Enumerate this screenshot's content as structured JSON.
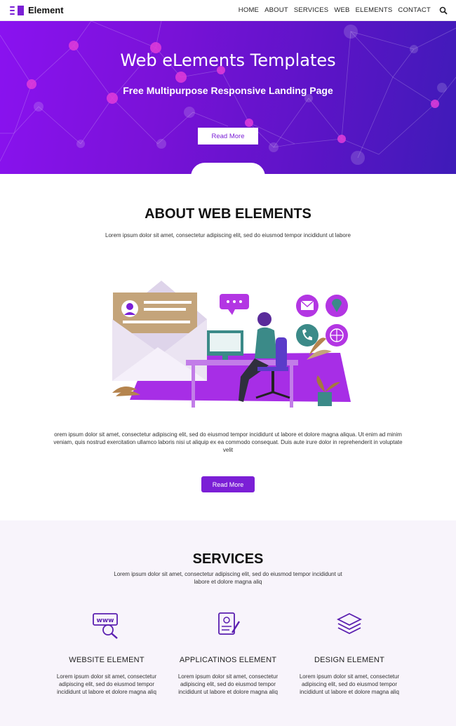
{
  "nav": {
    "brand": "Element",
    "items": [
      "HOME",
      "ABOUT",
      "SERVICES",
      "WEB",
      "ELEMENTS",
      "CONTACT"
    ],
    "search_icon": "search-icon"
  },
  "hero": {
    "title": "Web eLements Templates",
    "subtitle": "Free Multipurpose Responsive Landing Page",
    "button": "Read More"
  },
  "about": {
    "title": "ABOUT WEB ELEMENTS",
    "lead": "Lorem ipsum dolor sit amet, consectetur adipiscing elit, sed do eiusmod tempor incididunt ut labore",
    "paragraph": "orem ipsum dolor sit amet, consectetur adipiscing elit, sed do eiusmod tempor incididunt ut labore et dolore magna aliqua. Ut enim ad minim veniam, quis nostrud exercitation ullamco laboris nisi ut aliquip ex ea commodo consequat. Duis aute irure dolor in reprehenderit in voluptate velit",
    "button": "Read More"
  },
  "services": {
    "title": "SERVICES",
    "lead": "Lorem ipsum dolor sit amet, consectetur adipiscing elit, sed do eiusmod tempor incididunt ut labore et dolore magna aliq",
    "items": [
      {
        "name": "WEBSITE ELEMENT",
        "icon": "www-search-icon",
        "desc": "Lorem ipsum dolor sit amet, consectetur adipiscing elit, sed do eiusmod tempor incididunt ut labore et dolore magna aliq"
      },
      {
        "name": "APPLICATINOS ELEMENT",
        "icon": "document-edit-icon",
        "desc": "Lorem ipsum dolor sit amet, consectetur adipiscing elit, sed do eiusmod tempor incididunt ut labore et dolore magna aliq"
      },
      {
        "name": "DESIGN ELEMENT",
        "icon": "layers-icon",
        "desc": "Lorem ipsum dolor sit amet, consectetur adipiscing elit, sed do eiusmod tempor incididunt ut labore et dolore magna aliq"
      }
    ]
  },
  "colors": {
    "accent": "#7b1fd6",
    "hero_start": "#8a12f0",
    "hero_end": "#3e1bb8",
    "services_bg": "#f8f4fb"
  }
}
